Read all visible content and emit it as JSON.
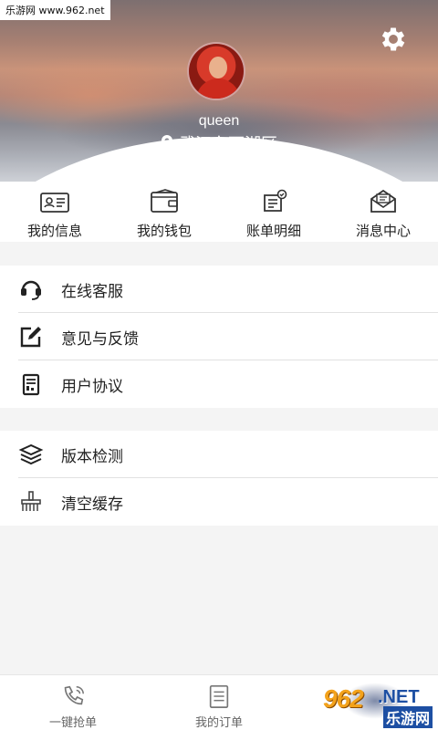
{
  "watermark": "乐游网 www.962.net",
  "profile": {
    "username": "queen",
    "location": "武汉东西湖区"
  },
  "quick_actions": [
    {
      "label": "我的信息",
      "icon": "id-card-icon"
    },
    {
      "label": "我的钱包",
      "icon": "wallet-icon"
    },
    {
      "label": "账单明细",
      "icon": "bill-icon"
    },
    {
      "label": "消息中心",
      "icon": "mail-icon"
    }
  ],
  "menu_group_1": [
    {
      "label": "在线客服",
      "icon": "headset-icon"
    },
    {
      "label": "意见与反馈",
      "icon": "edit-icon"
    },
    {
      "label": "用户协议",
      "icon": "document-icon"
    }
  ],
  "menu_group_2": [
    {
      "label": "版本检测",
      "icon": "layers-icon"
    },
    {
      "label": "清空缓存",
      "icon": "broom-icon"
    }
  ],
  "tabbar": [
    {
      "label": "一键抢单",
      "icon": "phone-icon"
    },
    {
      "label": "我的订单",
      "icon": "order-list-icon"
    }
  ],
  "brand_overlay": {
    "number": "962",
    "suffix": ".NET",
    "cn": "乐游网"
  },
  "colors": {
    "accent_orange": "#f3a21b",
    "accent_blue": "#1d4fa3",
    "text": "#222222"
  }
}
